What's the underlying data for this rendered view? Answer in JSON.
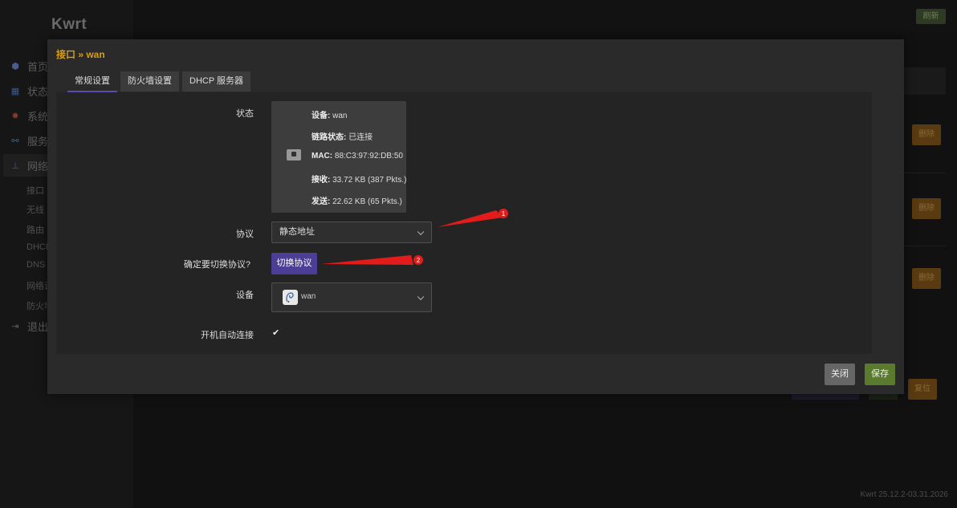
{
  "brand": "Kwrt",
  "header": {
    "refresh_label": "刷新"
  },
  "sidebar": {
    "items": [
      {
        "label": "首页",
        "icon": "home-icon"
      },
      {
        "label": "状态",
        "icon": "grid-icon"
      },
      {
        "label": "系统",
        "icon": "gear-icon"
      },
      {
        "label": "服务",
        "icon": "link-icon"
      },
      {
        "label": "网络",
        "icon": "network-icon"
      },
      {
        "label": "退出",
        "icon": "logout-icon"
      }
    ],
    "subitems": [
      "接口",
      "无线",
      "路由",
      "DHCP",
      "DNS",
      "网络诊",
      "防火墙"
    ]
  },
  "background": {
    "delete_label": "删除",
    "reset_label": "复位",
    "version": "Kwrt 25.12.2-03.31.2026"
  },
  "modal": {
    "title": "接口 » wan",
    "tabs": [
      {
        "label": "常规设置",
        "active": true
      },
      {
        "label": "防火墙设置",
        "active": false
      },
      {
        "label": "DHCP 服务器",
        "active": false
      }
    ],
    "fields": {
      "status_label": "状态",
      "protocol_label": "协议",
      "confirm_label": "确定要切换协议?",
      "device_label": "设备",
      "autostart_label": "开机自动连接"
    },
    "status": {
      "device_key": "设备:",
      "device_val": "wan",
      "link_key": "链路状态:",
      "link_val": "已连接",
      "mac_key": "MAC:",
      "mac_val": "88:C3:97:92:DB:50",
      "rx_key": "接收:",
      "rx_val": "33.72 KB (387 Pkts.)",
      "tx_key": "发送:",
      "tx_val": "22.62 KB (65 Pkts.)"
    },
    "protocol_value": "静态地址",
    "switch_button": "切换协议",
    "device_value": "wan",
    "autostart_checked": true,
    "close_button": "关闭",
    "save_button": "保存"
  },
  "annotations": [
    {
      "label": "1"
    },
    {
      "label": "2"
    }
  ],
  "colors": {
    "accent": "#4c3d96",
    "title": "#d39d1e",
    "save": "#5a7a2e",
    "annotation": "#e21b1b"
  }
}
